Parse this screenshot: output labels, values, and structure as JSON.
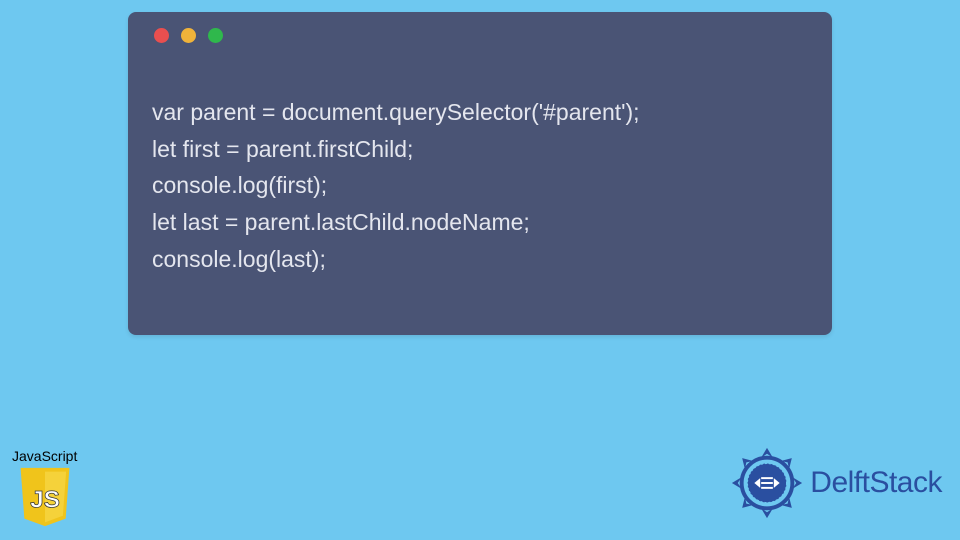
{
  "code": {
    "lines": [
      "var parent = document.querySelector('#parent');",
      "let first = parent.firstChild;",
      "console.log(first);",
      "let last = parent.lastChild.nodeName;",
      "console.log(last);"
    ]
  },
  "js_logo": {
    "label": "JavaScript",
    "letters": "JS"
  },
  "brand": {
    "name": "DelftStack"
  },
  "colors": {
    "bg": "#6ec8f0",
    "window": "#4a5475",
    "red": "#e94f4f",
    "yellow": "#f0b33a",
    "green": "#2fb84c",
    "js_yellow": "#f0c41b",
    "brand_blue": "#2a4fa0"
  }
}
